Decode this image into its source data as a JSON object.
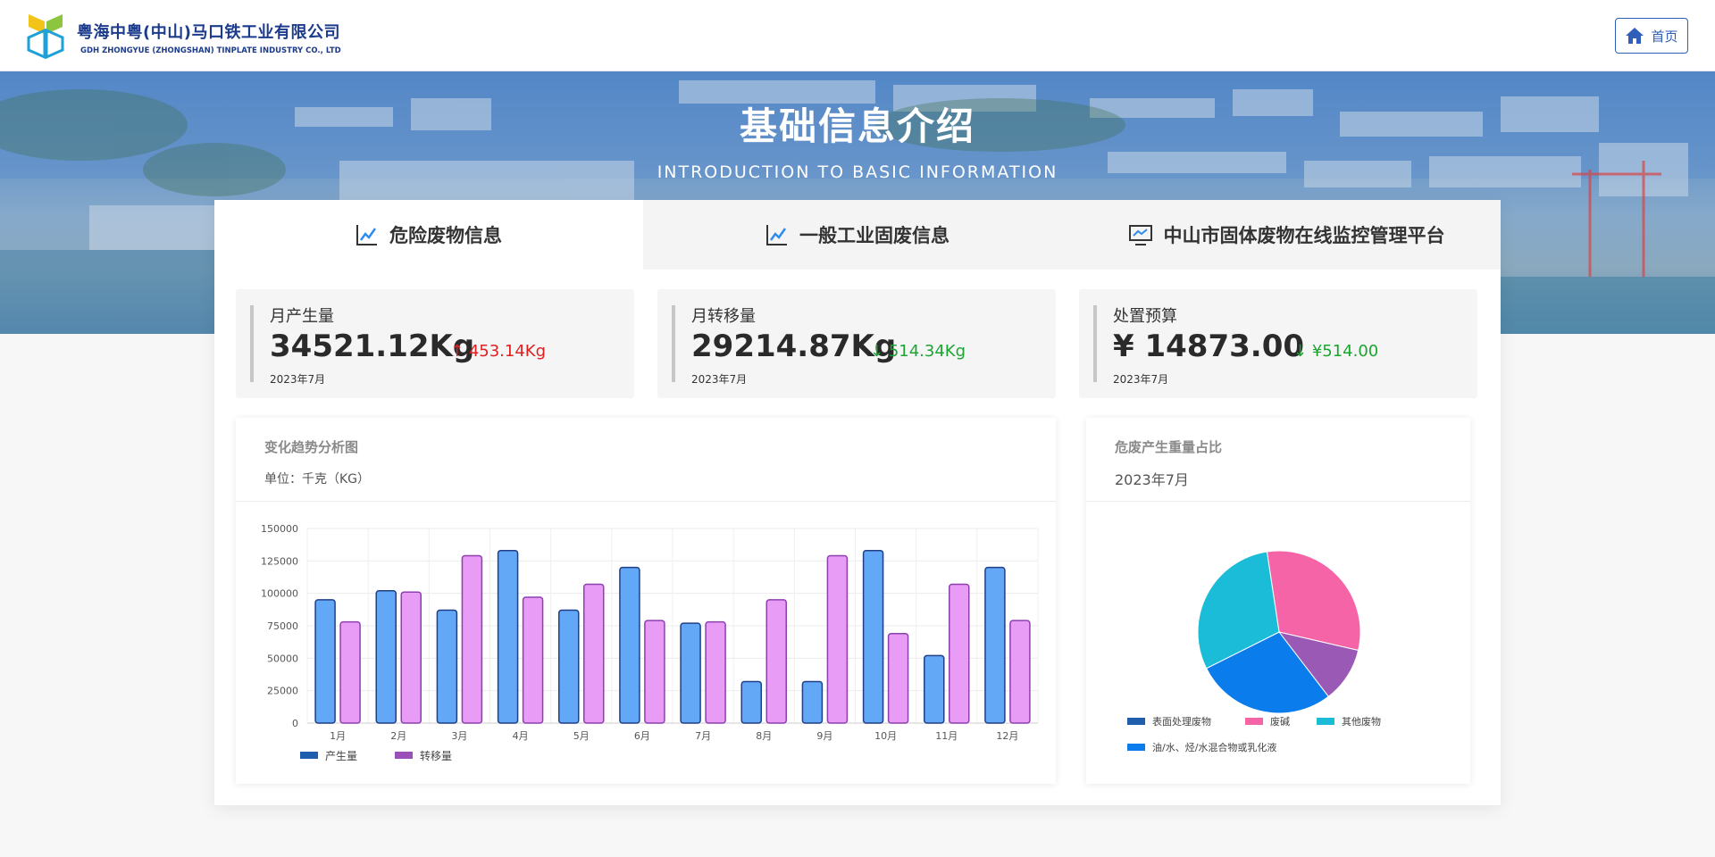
{
  "header": {
    "company_cn": "粤海中粤(中山)马口铁工业有限公司",
    "company_en": "GDH ZHONGYUE (ZHONGSHAN) TINPLATE  INDUSTRY CO., LTD",
    "home_label": "首页"
  },
  "hero": {
    "title": "基础信息介绍",
    "subtitle": "INTRODUCTION TO BASIC INFORMATION"
  },
  "tabs": [
    {
      "label": "危险废物信息",
      "icon": "line-chart-icon",
      "active": true
    },
    {
      "label": "一般工业固废信息",
      "icon": "line-chart-icon",
      "active": false
    },
    {
      "label": "中山市固体废物在线监控管理平台",
      "icon": "monitor-icon",
      "active": false
    }
  ],
  "stats": [
    {
      "label": "月产生量",
      "value": "34521.12Kg",
      "change": "453.14Kg",
      "direction": "up",
      "date": "2023年7月"
    },
    {
      "label": "月转移量",
      "value": "29214.87Kg",
      "change": "514.34Kg",
      "direction": "down",
      "date": "2023年7月"
    },
    {
      "label": "处置预算",
      "value": "¥ 14873.00",
      "change": "¥514.00",
      "direction": "down",
      "date": "2023年7月"
    }
  ],
  "colors": {
    "up": "#e02020",
    "down": "#1aa530",
    "brand": "#1c3b8c",
    "accent": "#2f5fb8"
  },
  "trend_panel": {
    "title": "变化趋势分析图",
    "unit": "单位：千克（KG）"
  },
  "pie_panel": {
    "title": "危废产生重量占比",
    "date": "2023年7月"
  },
  "chart_data": [
    {
      "type": "bar",
      "title": "变化趋势分析图",
      "ylabel": "单位：千克（KG）",
      "ylim": [
        0,
        150000
      ],
      "yticks": [
        0,
        25000,
        50000,
        75000,
        100000,
        125000,
        150000
      ],
      "categories": [
        "1月",
        "2月",
        "3月",
        "4月",
        "5月",
        "6月",
        "7月",
        "8月",
        "9月",
        "10月",
        "11月",
        "12月"
      ],
      "grid": true,
      "legend": "bottom-left",
      "series": [
        {
          "name": "产生量",
          "color": "#63a7f7",
          "legend_color": "#1f5fae",
          "values": [
            95000,
            102000,
            87000,
            133000,
            87000,
            120000,
            77000,
            32000,
            32000,
            133000,
            52000,
            120000
          ]
        },
        {
          "name": "转移量",
          "color": "#e89cf5",
          "legend_color": "#9b4fb8",
          "values": [
            78000,
            101000,
            129000,
            97000,
            107000,
            79000,
            78000,
            95000,
            129000,
            69000,
            107000,
            79000
          ]
        }
      ]
    },
    {
      "type": "pie",
      "title": "危废产生重量占比",
      "legend": "bottom",
      "slices": [
        {
          "name": "废碱",
          "value": 31,
          "color": "#f564a7"
        },
        {
          "name": "表面处理废物",
          "value": 11,
          "color": "#9b59b6",
          "legend_color": "#1f5fae"
        },
        {
          "name": "油/水、烃/水混合物或乳化液",
          "value": 28,
          "color": "#0a7cec"
        },
        {
          "name": "其他废物",
          "value": 30,
          "color": "#1bbcd8"
        }
      ],
      "legend_order": [
        "表面处理废物",
        "废碱",
        "其他废物",
        "油/水、烃/水混合物或乳化液"
      ]
    }
  ]
}
